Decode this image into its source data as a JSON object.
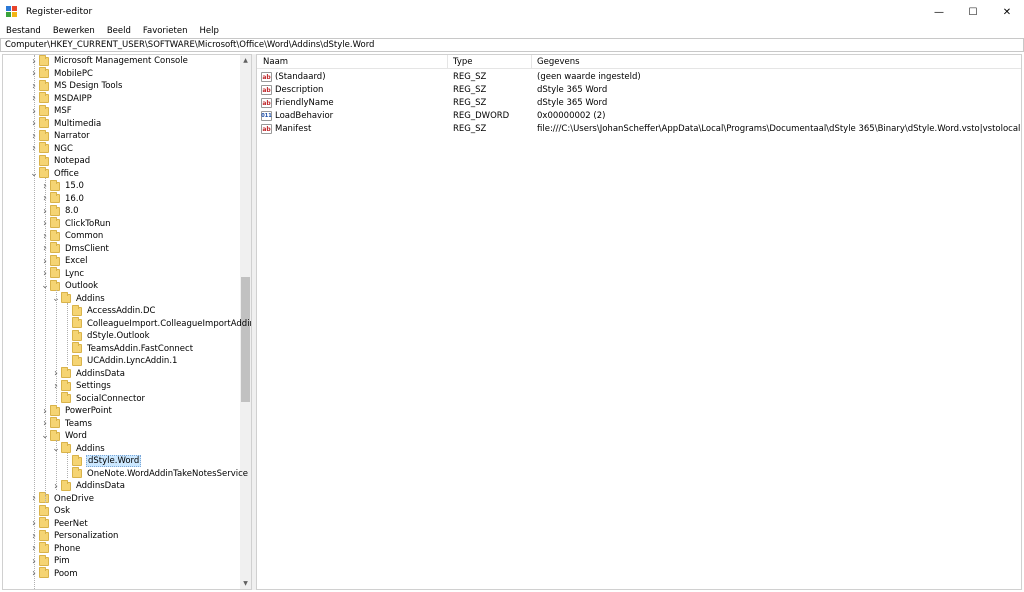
{
  "window": {
    "title": "Register-editor",
    "minimize": "—",
    "maximize": "☐",
    "close": "✕",
    "brand_colors": [
      "#2b79d6",
      "#e8442c",
      "#3aa33a",
      "#f2b515"
    ]
  },
  "menu": [
    "Bestand",
    "Bewerken",
    "Beeld",
    "Favorieten",
    "Help"
  ],
  "address": "Computer\\HKEY_CURRENT_USER\\SOFTWARE\\Microsoft\\Office\\Word\\Addins\\dStyle.Word",
  "tree": [
    {
      "label": "Microsoft Management Console",
      "level": 0,
      "state": "collapsed"
    },
    {
      "label": "MobilePC",
      "level": 0,
      "state": "collapsed"
    },
    {
      "label": "MS Design Tools",
      "level": 0,
      "state": "collapsed"
    },
    {
      "label": "MSDAIPP",
      "level": 0,
      "state": "collapsed"
    },
    {
      "label": "MSF",
      "level": 0,
      "state": "collapsed"
    },
    {
      "label": "Multimedia",
      "level": 0,
      "state": "collapsed"
    },
    {
      "label": "Narrator",
      "level": 0,
      "state": "collapsed"
    },
    {
      "label": "NGC",
      "level": 0,
      "state": "collapsed"
    },
    {
      "label": "Notepad",
      "level": 0,
      "state": "leaf"
    },
    {
      "label": "Office",
      "level": 0,
      "state": "expanded"
    },
    {
      "label": "15.0",
      "level": 1,
      "state": "collapsed"
    },
    {
      "label": "16.0",
      "level": 1,
      "state": "collapsed"
    },
    {
      "label": "8.0",
      "level": 1,
      "state": "collapsed"
    },
    {
      "label": "ClickToRun",
      "level": 1,
      "state": "collapsed"
    },
    {
      "label": "Common",
      "level": 1,
      "state": "collapsed"
    },
    {
      "label": "DmsClient",
      "level": 1,
      "state": "collapsed"
    },
    {
      "label": "Excel",
      "level": 1,
      "state": "collapsed"
    },
    {
      "label": "Lync",
      "level": 1,
      "state": "collapsed"
    },
    {
      "label": "Outlook",
      "level": 1,
      "state": "expanded"
    },
    {
      "label": "Addins",
      "level": 2,
      "state": "expanded"
    },
    {
      "label": "AccessAddin.DC",
      "level": 3,
      "state": "leaf"
    },
    {
      "label": "ColleagueImport.ColleagueImportAddin",
      "level": 3,
      "state": "leaf"
    },
    {
      "label": "dStyle.Outlook",
      "level": 3,
      "state": "leaf"
    },
    {
      "label": "TeamsAddin.FastConnect",
      "level": 3,
      "state": "leaf"
    },
    {
      "label": "UCAddin.LyncAddin.1",
      "level": 3,
      "state": "leaf"
    },
    {
      "label": "AddinsData",
      "level": 2,
      "state": "collapsed"
    },
    {
      "label": "Settings",
      "level": 2,
      "state": "collapsed"
    },
    {
      "label": "SocialConnector",
      "level": 2,
      "state": "leaf"
    },
    {
      "label": "PowerPoint",
      "level": 1,
      "state": "collapsed"
    },
    {
      "label": "Teams",
      "level": 1,
      "state": "collapsed"
    },
    {
      "label": "Word",
      "level": 1,
      "state": "expanded"
    },
    {
      "label": "Addins",
      "level": 2,
      "state": "expanded"
    },
    {
      "label": "dStyle.Word",
      "level": 3,
      "state": "leaf",
      "selected": true
    },
    {
      "label": "OneNote.WordAddinTakeNotesService",
      "level": 3,
      "state": "leaf"
    },
    {
      "label": "AddinsData",
      "level": 2,
      "state": "collapsed"
    },
    {
      "label": "OneDrive",
      "level": 0,
      "state": "collapsed"
    },
    {
      "label": "Osk",
      "level": 0,
      "state": "leaf"
    },
    {
      "label": "PeerNet",
      "level": 0,
      "state": "collapsed"
    },
    {
      "label": "Personalization",
      "level": 0,
      "state": "collapsed"
    },
    {
      "label": "Phone",
      "level": 0,
      "state": "collapsed"
    },
    {
      "label": "Pim",
      "level": 0,
      "state": "collapsed"
    },
    {
      "label": "Poom",
      "level": 0,
      "state": "collapsed"
    }
  ],
  "list": {
    "headers": {
      "name": "Naam",
      "type": "Type",
      "data": "Gegevens"
    },
    "rows": [
      {
        "icon": "ab",
        "kind": "sz",
        "name": "(Standaard)",
        "type": "REG_SZ",
        "data": "(geen waarde ingesteld)"
      },
      {
        "icon": "ab",
        "kind": "sz",
        "name": "Description",
        "type": "REG_SZ",
        "data": "dStyle 365 Word"
      },
      {
        "icon": "ab",
        "kind": "sz",
        "name": "FriendlyName",
        "type": "REG_SZ",
        "data": "dStyle 365 Word"
      },
      {
        "icon": "011",
        "kind": "dw",
        "name": "LoadBehavior",
        "type": "REG_DWORD",
        "data": "0x00000002 (2)"
      },
      {
        "icon": "ab",
        "kind": "sz",
        "name": "Manifest",
        "type": "REG_SZ",
        "data": "file:///C:\\Users\\JohanScheffer\\AppData\\Local\\Programs\\Documentaal\\dStyle 365\\Binary\\dStyle.Word.vsto|vstolocal"
      }
    ]
  },
  "scrollbar": {
    "up": "▲",
    "down": "▼"
  }
}
